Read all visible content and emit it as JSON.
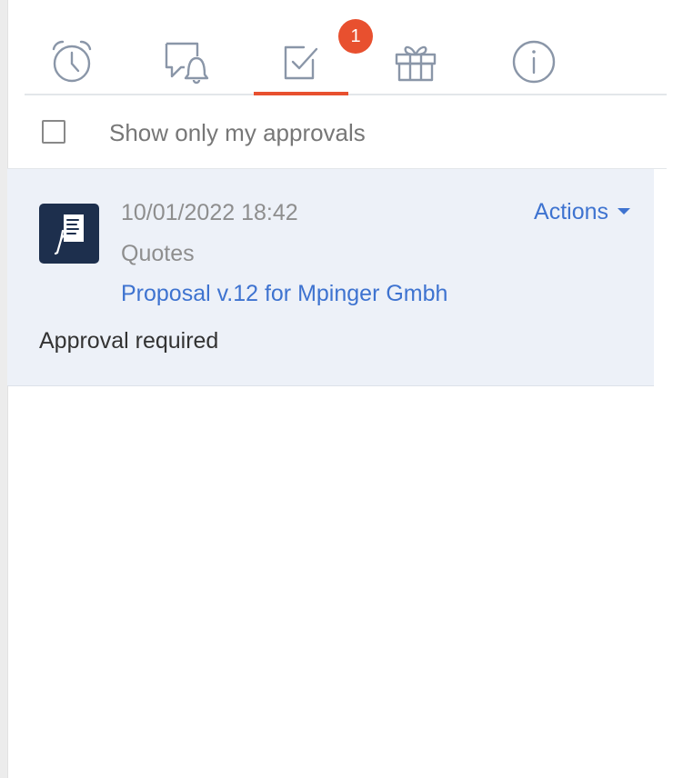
{
  "tabs": [
    {
      "icon": "alarm-clock-icon"
    },
    {
      "icon": "chat-bell-icon"
    },
    {
      "icon": "approval-check-icon",
      "active": true,
      "badge": "1"
    },
    {
      "icon": "gift-icon"
    },
    {
      "icon": "info-icon"
    }
  ],
  "filter": {
    "label": "Show only my approvals",
    "checked": false
  },
  "approval": {
    "datetime": "10/01/2022 18:42",
    "module": "Quotes",
    "title": "Proposal v.12 for Mpinger Gmbh",
    "actions_label": "Actions",
    "status": "Approval required",
    "icon": "document-hand-icon"
  },
  "colors": {
    "accent": "#e8502f",
    "link": "#3e73d0",
    "card_bg": "#edf1f8",
    "icon_tile": "#1d2f4d"
  }
}
